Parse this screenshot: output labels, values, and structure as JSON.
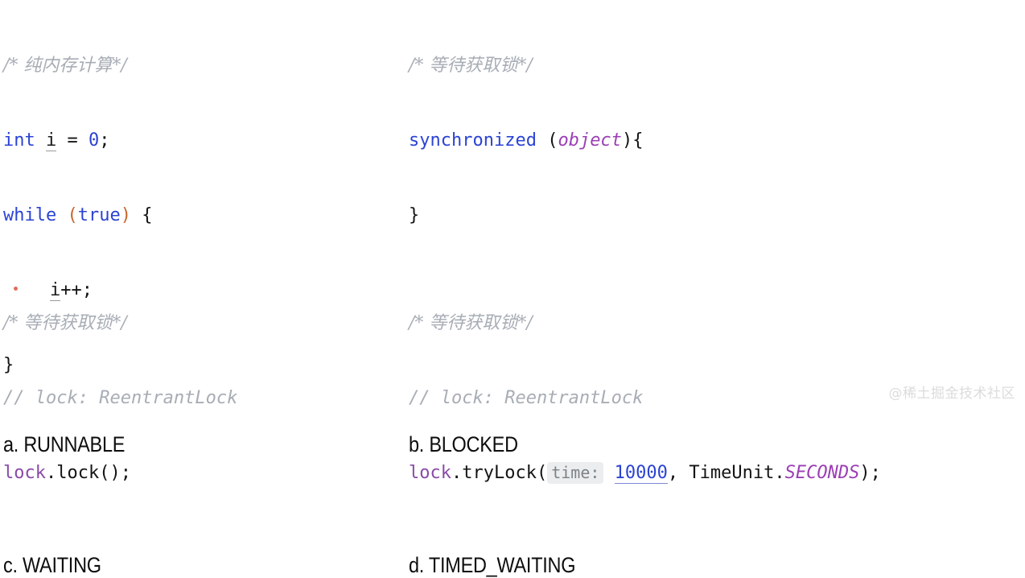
{
  "panels": [
    {
      "id": "a",
      "comment_cn": "/* 纯内存计算*/",
      "code": {
        "l1_kw": "int",
        "l1_var": "i",
        "l1_eq": " = ",
        "l1_num": "0",
        "l1_semi": ";",
        "l2_kw": "while",
        "l2_open": " (",
        "l2_true": "true",
        "l2_close": ")",
        "l2_brace": " {",
        "l3_var": "i",
        "l3_rest": "++;",
        "l4_brace": "}"
      },
      "label": "a. RUNNABLE"
    },
    {
      "id": "b",
      "comment_cn": "/* 等待获取锁*/",
      "code": {
        "l1_kw": "synchronized",
        "l1_open": " (",
        "l1_obj": "object",
        "l1_close": ")",
        "l1_brace": "{",
        "l2_brace": "}"
      },
      "label": "b. BLOCKED"
    },
    {
      "id": "c",
      "comment_cn": "/* 等待获取锁*/",
      "comment_line": "// lock: ReentrantLock",
      "code": {
        "l1_field": "lock",
        "l1_rest": ".lock();"
      },
      "label": "c. WAITING"
    },
    {
      "id": "d",
      "comment_cn": "/* 等待获取锁*/",
      "comment_line": "// lock: ReentrantLock",
      "code": {
        "l1_field": "lock",
        "l1_method": ".tryLock(",
        "l1_hint": "time:",
        "l1_num": "10000",
        "l1_comma": ", ",
        "l1_class": "TimeUnit.",
        "l1_const": "SECONDS",
        "l1_tail": ");"
      },
      "label": "d. TIMED_WAITING"
    }
  ],
  "watermark": "@稀土掘金技术社区",
  "colors": {
    "keyword": "#2b43d4",
    "number": "#2b43d4",
    "comment": "#a8adb5",
    "field": "#8a4ba8",
    "static_const": "#9b3fb5",
    "bracket": "#c7652a",
    "local_var": "#c7652a",
    "plain": "#141414",
    "param_hint_bg": "#ebedee",
    "param_hint_fg": "#7d8287",
    "watermark": "#dcdcdc",
    "background": "#ffffff"
  }
}
